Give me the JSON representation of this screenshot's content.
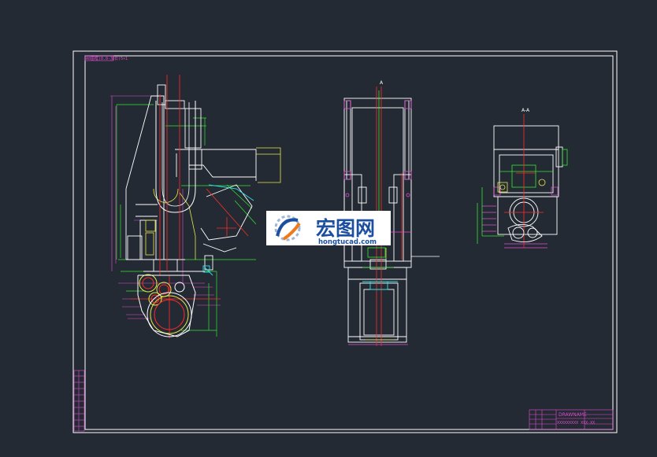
{
  "sheet": {
    "top_left_tag": "A0图框(0.0-加长)5×1"
  },
  "views": {
    "view1_mark": "A",
    "view2_mark": "A-A"
  },
  "watermark": {
    "cn": "宏图网",
    "en": "hongtucad.com"
  },
  "title_block": {
    "drawing_name": "DRAWNAME",
    "subtitle": "XXXXXXXXX  XXX-XX"
  },
  "colors": {
    "background": "#242a33",
    "frame": "#ffffff",
    "red": "#ff2b2b",
    "green": "#33e633",
    "yellow": "#e6e64a",
    "magenta": "#e34bd0",
    "cyan": "#2ee0e6"
  }
}
